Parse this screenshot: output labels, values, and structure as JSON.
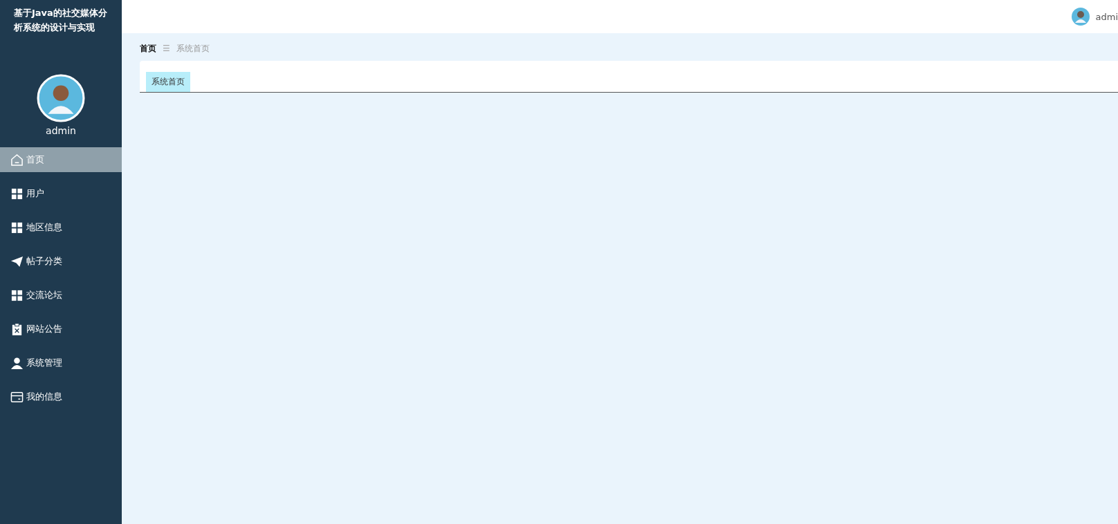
{
  "sidebar": {
    "title": "基于Java的社交媒体分析系统的设计与实现",
    "username": "admin",
    "items": [
      {
        "label": "首页",
        "selected": true
      },
      {
        "label": "用户",
        "selected": false
      },
      {
        "label": "地区信息",
        "selected": false
      },
      {
        "label": "帖子分类",
        "selected": false
      },
      {
        "label": "交流论坛",
        "selected": false
      },
      {
        "label": "网站公告",
        "selected": false
      },
      {
        "label": "系统管理",
        "selected": false
      },
      {
        "label": "我的信息",
        "selected": false
      }
    ]
  },
  "header": {
    "username": "admi"
  },
  "breadcrumb": {
    "items": [
      "首页",
      "系统首页"
    ],
    "separator": "☰"
  },
  "tabs": [
    {
      "label": "系统首页",
      "selected": true
    }
  ]
}
